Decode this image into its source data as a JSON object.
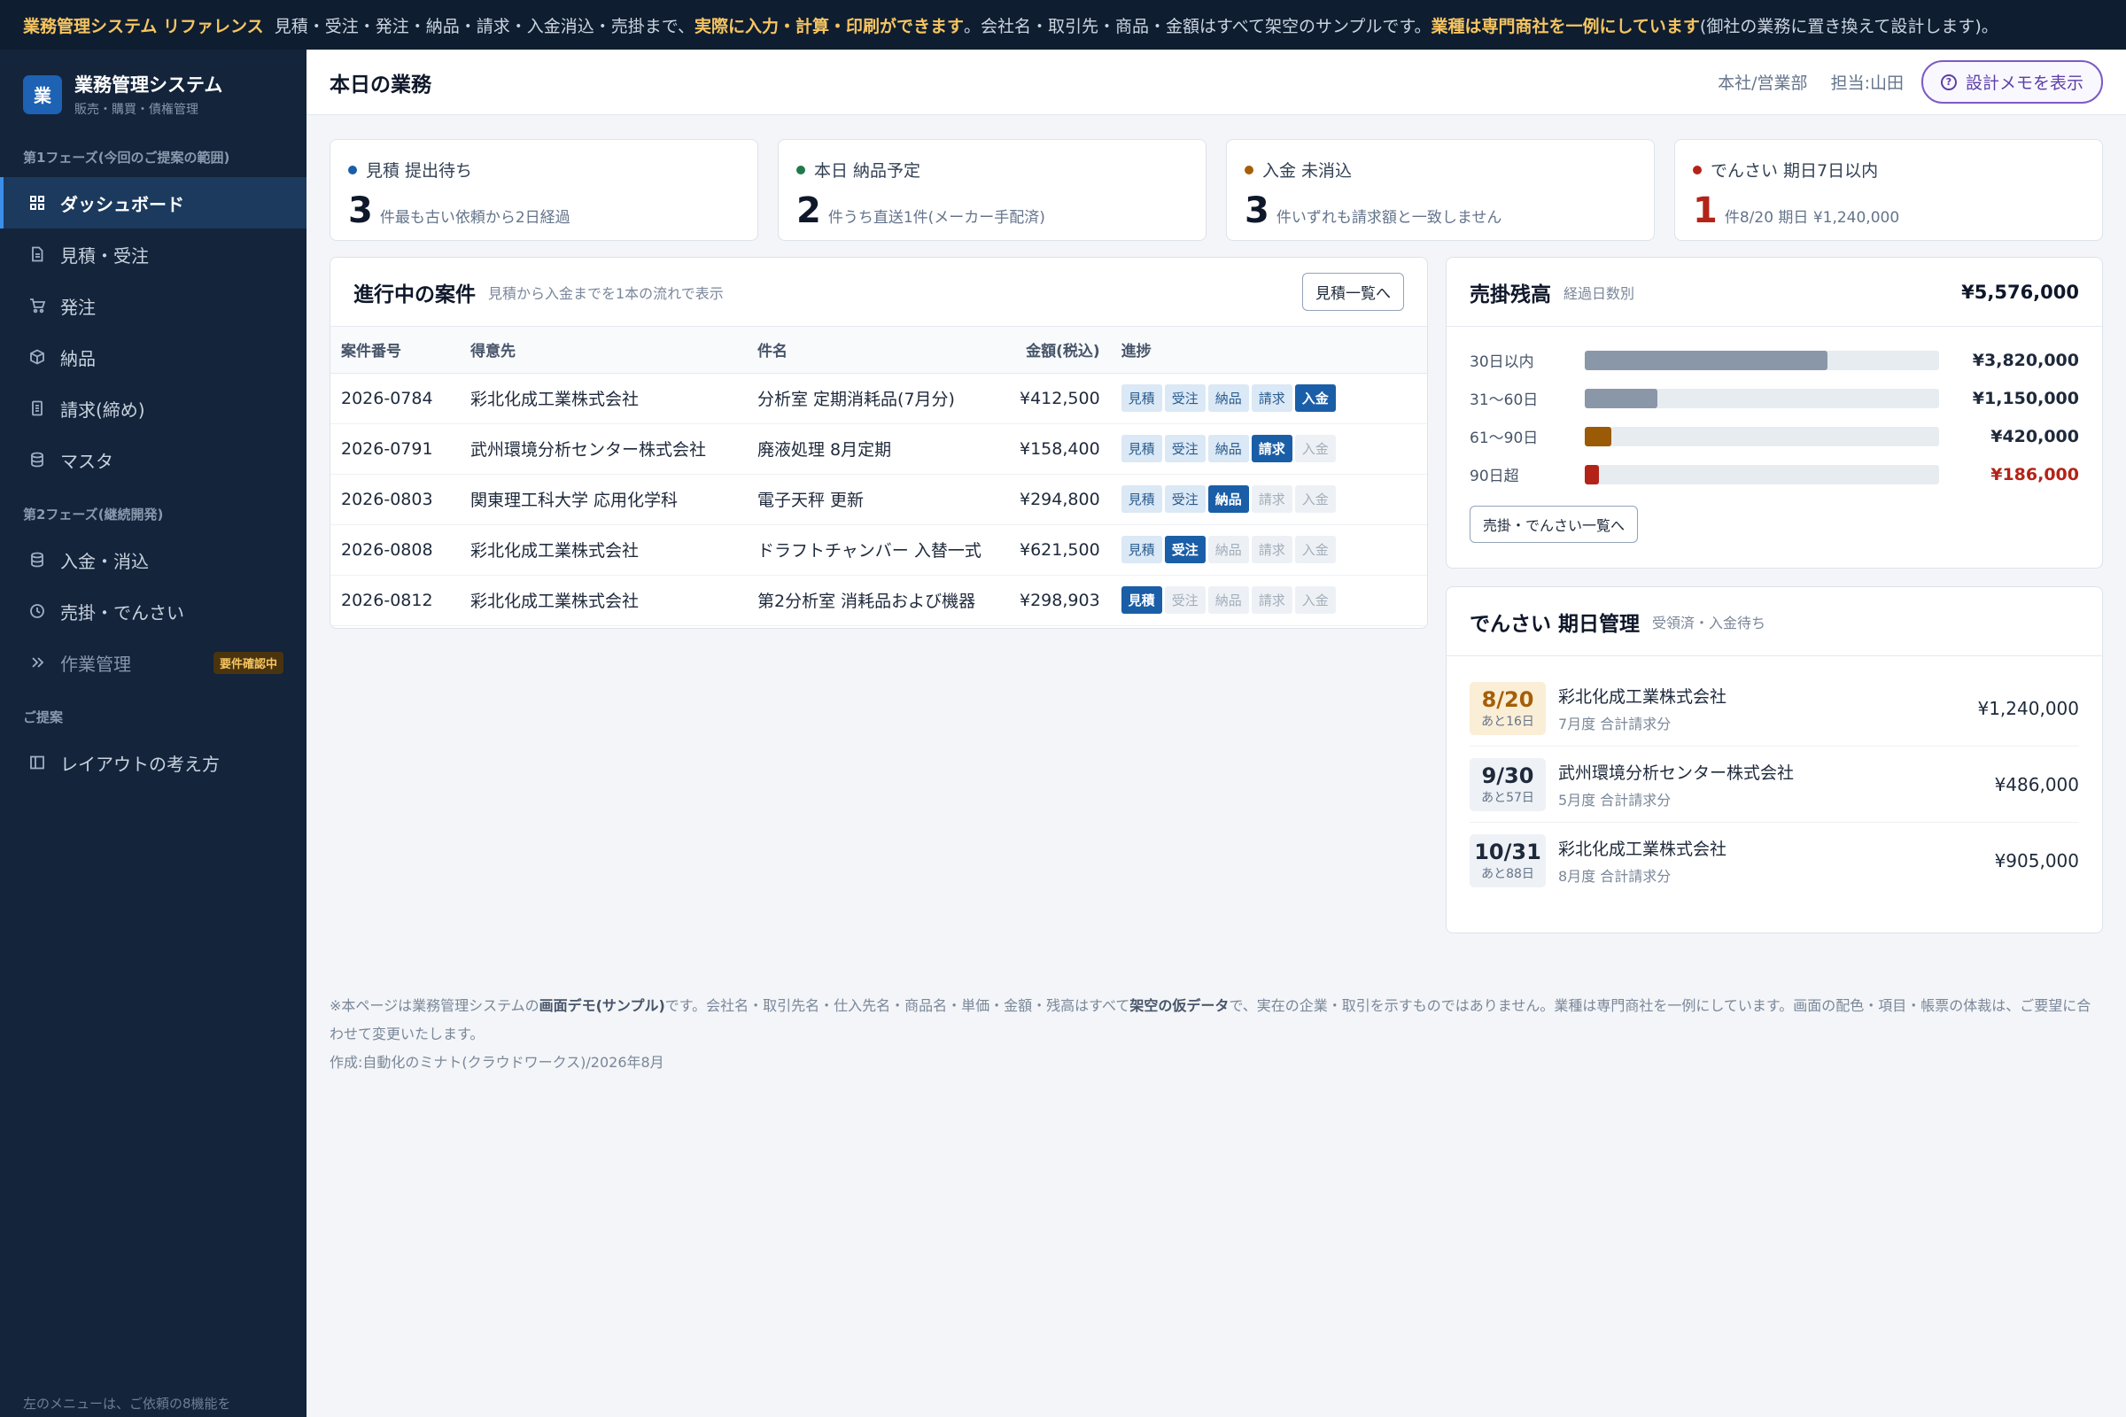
{
  "banner": {
    "part1": "業務管理システム リファレンス",
    "part2": "見積・受注・発注・納品・請求・入金消込・売掛まで、",
    "part3": "実際に入力・計算・印刷ができます",
    "part4": "。会社名・取引先・商品・金額はすべて架空のサンプルです。",
    "part5": "業種は専門商社を一例にしています",
    "part6": "(御社の業務に置き換えて設計します)。"
  },
  "brand": {
    "logo": "業",
    "title": "業務管理システム",
    "sub": "販売・購買・債権管理"
  },
  "sidebar": {
    "phase1_title": "第1フェーズ(今回のご提案の範囲)",
    "phase1": [
      {
        "label": "ダッシュボード"
      },
      {
        "label": "見積・受注"
      },
      {
        "label": "発注"
      },
      {
        "label": "納品"
      },
      {
        "label": "請求(締め)"
      },
      {
        "label": "マスタ"
      }
    ],
    "phase2_title": "第2フェーズ(継続開発)",
    "phase2": [
      {
        "label": "入金・消込"
      },
      {
        "label": "売掛・でんさい"
      },
      {
        "label": "作業管理",
        "badge": "要件確認中"
      }
    ],
    "proposal_title": "ご提案",
    "proposal": [
      {
        "label": "レイアウトの考え方"
      }
    ],
    "footer": "左のメニューは、ご依頼の8機能を"
  },
  "header": {
    "title": "本日の業務",
    "dept": "本社/営業部",
    "user": "担当:山田",
    "memo_button": "設計メモを表示"
  },
  "stats": [
    {
      "label": "見積 提出待ち",
      "num": "3",
      "note": "件最も古い依頼から2日経過",
      "color": "#1a5ea8"
    },
    {
      "label": "本日 納品予定",
      "num": "2",
      "note": "件うち直送1件(メーカー手配済)",
      "color": "#1f7a4a"
    },
    {
      "label": "入金 未消込",
      "num": "3",
      "note": "件いずれも請求額と一致しません",
      "color": "#a55f07"
    },
    {
      "label": "でんさい 期日7日以内",
      "num": "1",
      "note": "件8/20 期日 ¥1,240,000",
      "color": "#b42318",
      "num_color": "#b42318"
    }
  ],
  "projects": {
    "title": "進行中の案件",
    "sub": "見積から入金までを1本の流れで表示",
    "button": "見積一覧へ",
    "columns": [
      "案件番号",
      "得意先",
      "件名",
      "金額(税込)",
      "進捗"
    ],
    "step_labels": [
      "見積",
      "受注",
      "納品",
      "請求",
      "入金"
    ],
    "rows": [
      {
        "no": "2026-0784",
        "customer": "彩北化成工業株式会社",
        "subject": "分析室 定期消耗品(7月分)",
        "amount": "¥412,500",
        "stage": 4
      },
      {
        "no": "2026-0791",
        "customer": "武州環境分析センター株式会社",
        "subject": "廃液処理 8月定期",
        "amount": "¥158,400",
        "stage": 3
      },
      {
        "no": "2026-0803",
        "customer": "関東理工科大学 応用化学科",
        "subject": "電子天秤 更新",
        "amount": "¥294,800",
        "stage": 2
      },
      {
        "no": "2026-0808",
        "customer": "彩北化成工業株式会社",
        "subject": "ドラフトチャンバー 入替一式",
        "amount": "¥621,500",
        "stage": 1
      },
      {
        "no": "2026-0812",
        "customer": "彩北化成工業株式会社",
        "subject": "第2分析室 消耗品および機器",
        "amount": "¥298,903",
        "stage": 0
      }
    ]
  },
  "aging": {
    "title": "売掛残高",
    "sub": "経過日数別",
    "total": "¥5,576,000",
    "button": "売掛・でんさい一覧へ",
    "rows": [
      {
        "label": "30日以内",
        "value": "¥3,820,000",
        "fraction": 0.685,
        "color": "#8a97a8"
      },
      {
        "label": "31〜60日",
        "value": "¥1,150,000",
        "fraction": 0.206,
        "color": "#8a97a8"
      },
      {
        "label": "61〜90日",
        "value": "¥420,000",
        "fraction": 0.075,
        "color": "#9a5a06"
      },
      {
        "label": "90日超",
        "value": "¥186,000",
        "fraction": 0.04,
        "color": "#b42318",
        "value_color": "#b42318"
      }
    ]
  },
  "densai": {
    "title": "でんさい 期日管理",
    "sub": "受領済・入金待ち",
    "rows": [
      {
        "date": "8/20",
        "remain": "あと16日",
        "name": "彩北化成工業株式会社",
        "desc": "7月度 合計請求分",
        "amount": "¥1,240,000",
        "warn": true
      },
      {
        "date": "9/30",
        "remain": "あと57日",
        "name": "武州環境分析センター株式会社",
        "desc": "5月度 合計請求分",
        "amount": "¥486,000",
        "warn": false
      },
      {
        "date": "10/31",
        "remain": "あと88日",
        "name": "彩北化成工業株式会社",
        "desc": "8月度 合計請求分",
        "amount": "¥905,000",
        "warn": false
      }
    ]
  },
  "footnote": {
    "a": "※本ページは業務管理システムの",
    "b": "画面デモ(サンプル)",
    "c": "です。会社名・取引先名・仕入先名・商品名・単価・金額・残高はすべて",
    "d": "架空の仮データ",
    "e": "で、実在の企業・取引を示すものではありません。業種は専門商社を一例にしています。画面の配色・項目・帳票の体裁は、ご要望に合わせて変更いたします。",
    "credit": "作成:自動化のミナト(クラウドワークス)/2026年8月"
  }
}
